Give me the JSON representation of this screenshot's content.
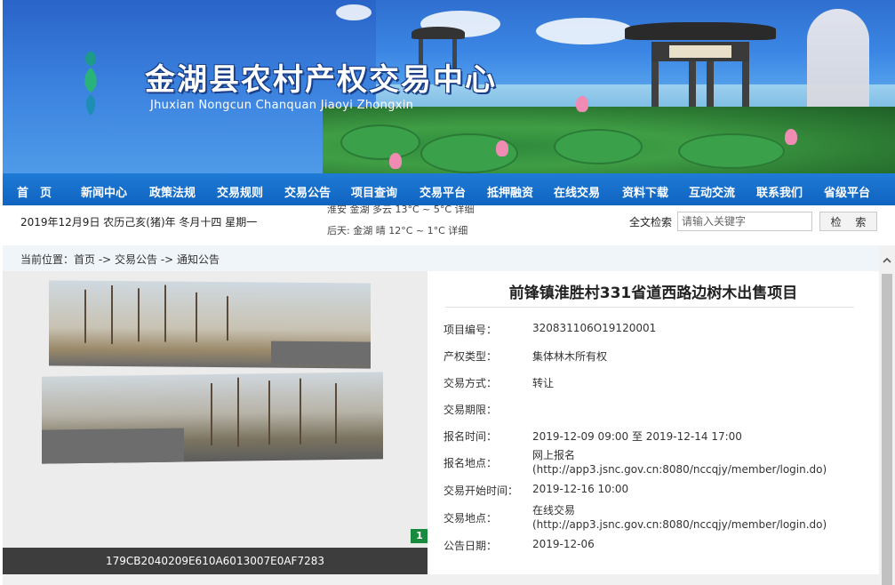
{
  "banner": {
    "title_cn": "金湖县农村产权交易中心",
    "title_en": "Jhuxian Nongcun Chanquan Jiaoyi Zhongxin"
  },
  "nav": {
    "items": [
      "首　页",
      "新闻中心",
      "政策法规",
      "交易规则",
      "交易公告",
      "项目查询",
      "交易平台",
      "抵押融资",
      "在线交易",
      "资料下载",
      "互动交流",
      "联系我们",
      "省级平台"
    ]
  },
  "infobar": {
    "date": "2019年12月9日  农历己亥(猪)年 冬月十四 星期一",
    "weather_row1": "淮安 金湖   多云  13°C ~ 5°C 详细",
    "weather_row2": "后天: 金湖   晴  12°C ~ 1°C 详细",
    "search_label": "全文检索",
    "search_placeholder": "请输入关键字",
    "search_button": "检 索"
  },
  "breadcrumb": "当前位置：首页 -> 交易公告 -> 通知公告",
  "gallery": {
    "badge": "1",
    "caption": "179CB2040209E610A6013007E0AF7283"
  },
  "detail": {
    "title": "前锋镇淮胜村331省道西路边树木出售项目",
    "fields": [
      {
        "label": "项目编号：",
        "value": "320831106O19120001"
      },
      {
        "label": "产权类型：",
        "value": "集体林木所有权"
      },
      {
        "label": "交易方式：",
        "value": "转让"
      },
      {
        "label": "交易期限：",
        "value": ""
      },
      {
        "label": "报名时间：",
        "value": "2019-12-09 09:00  至 2019-12-14 17:00"
      },
      {
        "label": "报名地点：",
        "value": "网上报名",
        "value2": "(http://app3.jsnc.gov.cn:8080/nccqjy/member/login.do)"
      },
      {
        "label": "交易开始时间：",
        "value": "2019-12-16 10:00"
      },
      {
        "label": "交易地点：",
        "value": "在线交易",
        "value2": "(http://app3.jsnc.gov.cn:8080/nccqjy/member/login.do)"
      },
      {
        "label": "公告日期：",
        "value": "2019-12-06"
      }
    ]
  }
}
